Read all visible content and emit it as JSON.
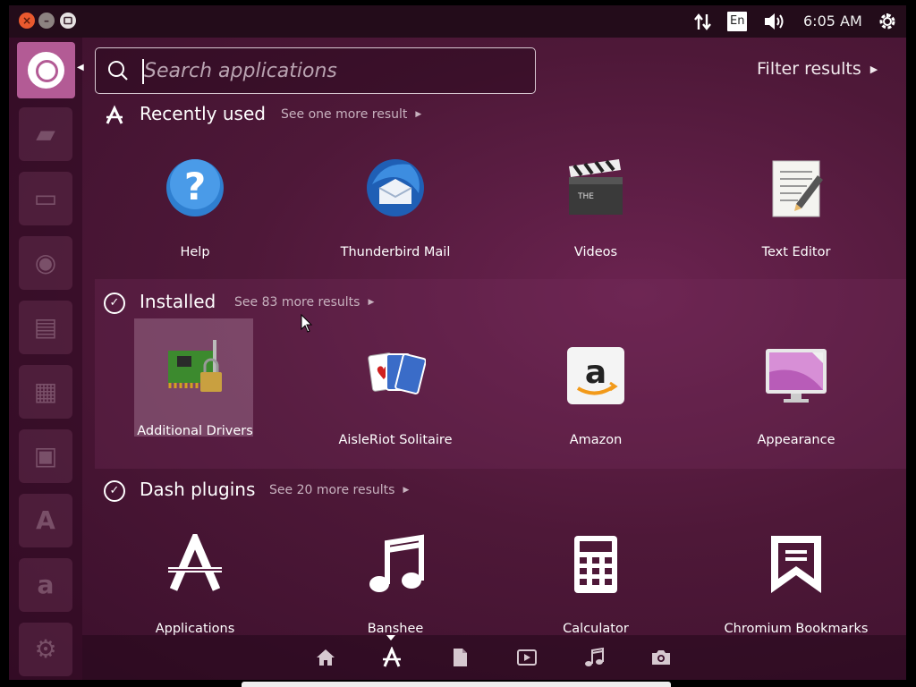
{
  "top_panel": {
    "keyboard_layout": "En",
    "clock": "6:05 AM",
    "network_icon": "network-transfer-icon",
    "volume_icon": "volume-icon",
    "power_icon": "power-gear-icon"
  },
  "launcher": {
    "items": [
      {
        "name": "ubuntu-dash",
        "icon": "ubuntu-logo-icon"
      },
      {
        "name": "files",
        "icon": "folder-icon"
      },
      {
        "name": "archive",
        "icon": "archive-icon"
      },
      {
        "name": "firefox",
        "icon": "firefox-icon"
      },
      {
        "name": "writer",
        "icon": "writer-icon"
      },
      {
        "name": "calc",
        "icon": "calc-icon"
      },
      {
        "name": "impress",
        "icon": "impress-icon"
      },
      {
        "name": "software-center",
        "icon": "software-center-icon"
      },
      {
        "name": "amazon",
        "icon": "amazon-icon"
      },
      {
        "name": "settings",
        "icon": "settings-icon"
      }
    ]
  },
  "search": {
    "placeholder": "Search applications",
    "value": ""
  },
  "filter": {
    "label": "Filter results"
  },
  "sections": {
    "recent": {
      "title": "Recently used",
      "more": "See one more result",
      "apps": [
        {
          "label": "Help",
          "icon": "help-icon"
        },
        {
          "label": "Thunderbird Mail",
          "icon": "thunderbird-icon"
        },
        {
          "label": "Videos",
          "icon": "videos-clapperboard-icon"
        },
        {
          "label": "Text Editor",
          "icon": "text-editor-icon"
        }
      ]
    },
    "installed": {
      "title": "Installed",
      "more": "See 83 more results",
      "apps": [
        {
          "label": "Additional Drivers",
          "icon": "additional-drivers-icon"
        },
        {
          "label": "AisleRiot Solitaire",
          "icon": "solitaire-cards-icon"
        },
        {
          "label": "Amazon",
          "icon": "amazon-icon"
        },
        {
          "label": "Appearance",
          "icon": "appearance-monitor-icon"
        }
      ]
    },
    "plugins": {
      "title": "Dash plugins",
      "more": "See 20 more results",
      "apps": [
        {
          "label": "Applications",
          "icon": "applications-lens-icon"
        },
        {
          "label": "Banshee",
          "icon": "music-note-icon"
        },
        {
          "label": "Calculator",
          "icon": "calculator-icon"
        },
        {
          "label": "Chromium Bookmarks",
          "icon": "bookmark-icon"
        }
      ]
    }
  },
  "lens_bar": {
    "lenses": [
      "home-lens-icon",
      "applications-lens-icon",
      "files-lens-icon",
      "video-lens-icon",
      "music-lens-icon",
      "photo-lens-icon"
    ],
    "active": "applications-lens-icon"
  },
  "colors": {
    "dash_background": "#4e1838",
    "launcher_highlight": "#b35b95",
    "close_button": "#e9592e"
  }
}
